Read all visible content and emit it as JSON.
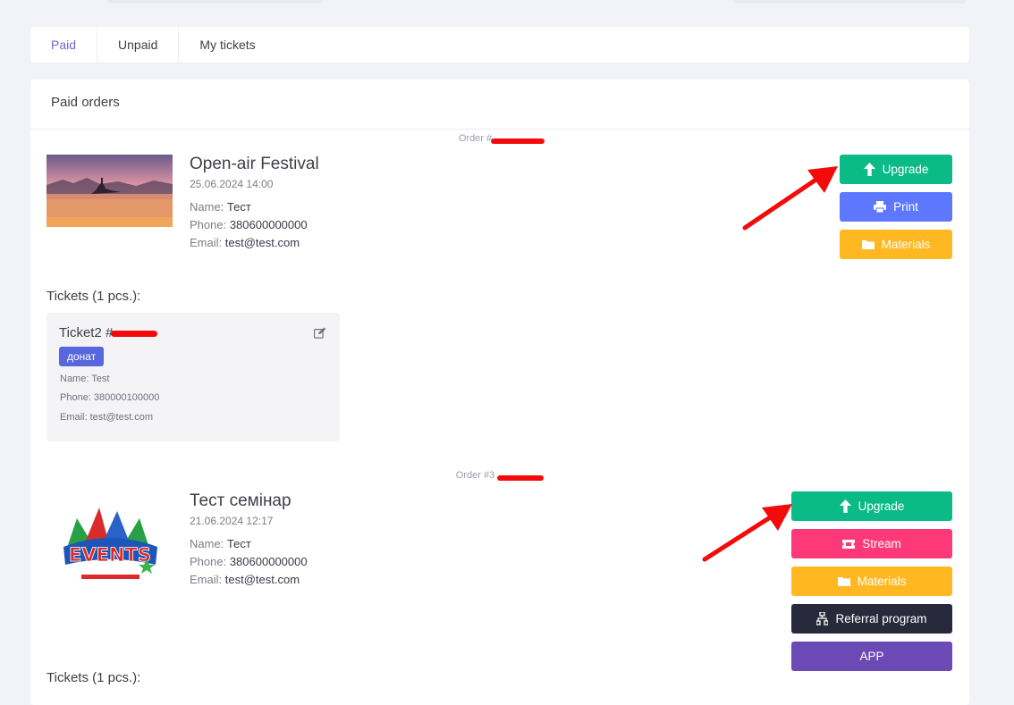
{
  "tabs": [
    {
      "label": "Paid"
    },
    {
      "label": "Unpaid"
    },
    {
      "label": "My tickets"
    }
  ],
  "section_title": "Paid orders",
  "orders": [
    {
      "order_number": "Order #",
      "event_title": "Open-air Festival",
      "date": "25.06.2024 14:00",
      "name_label": "Name:",
      "name": "Тест",
      "phone_label": "Phone:",
      "phone": "380600000000",
      "email_label": "Email:",
      "email": "test@test.com",
      "buttons": {
        "upgrade": "Upgrade",
        "print": "Print",
        "materials": "Materials"
      },
      "tickets_label": "Tickets (1 pcs.):",
      "ticket": {
        "title": "Ticket2 #",
        "badge": "донат",
        "name": "Name: Test",
        "phone": "Phone: 380000100000",
        "email": "Email: test@test.com"
      }
    },
    {
      "order_number": "Order #3",
      "event_title": "Тест семінар",
      "date": "21.06.2024 12:17",
      "name_label": "Name:",
      "name": "Тест",
      "phone_label": "Phone:",
      "phone": "380600000000",
      "email_label": "Email:",
      "email": "test@test.com",
      "logo_text": "EVENTS",
      "buttons": {
        "upgrade": "Upgrade",
        "stream": "Stream",
        "materials": "Materials",
        "referral": "Referral program",
        "app": "APP"
      },
      "tickets_label": "Tickets (1 pcs.):"
    }
  ],
  "colors": {
    "upgrade": "#0abb87",
    "print": "#5d78ff",
    "materials": "#ffb822",
    "stream": "#fd397a",
    "referral": "#282a3c",
    "app": "#6c4ab6",
    "tab_active": "#716aca",
    "badge": "#5867dd",
    "annotation": "#f30b0b"
  },
  "icons": [
    "arrow-up-icon",
    "printer-icon",
    "folder-icon",
    "ticket-icon",
    "referral-icon",
    "edit-icon"
  ]
}
